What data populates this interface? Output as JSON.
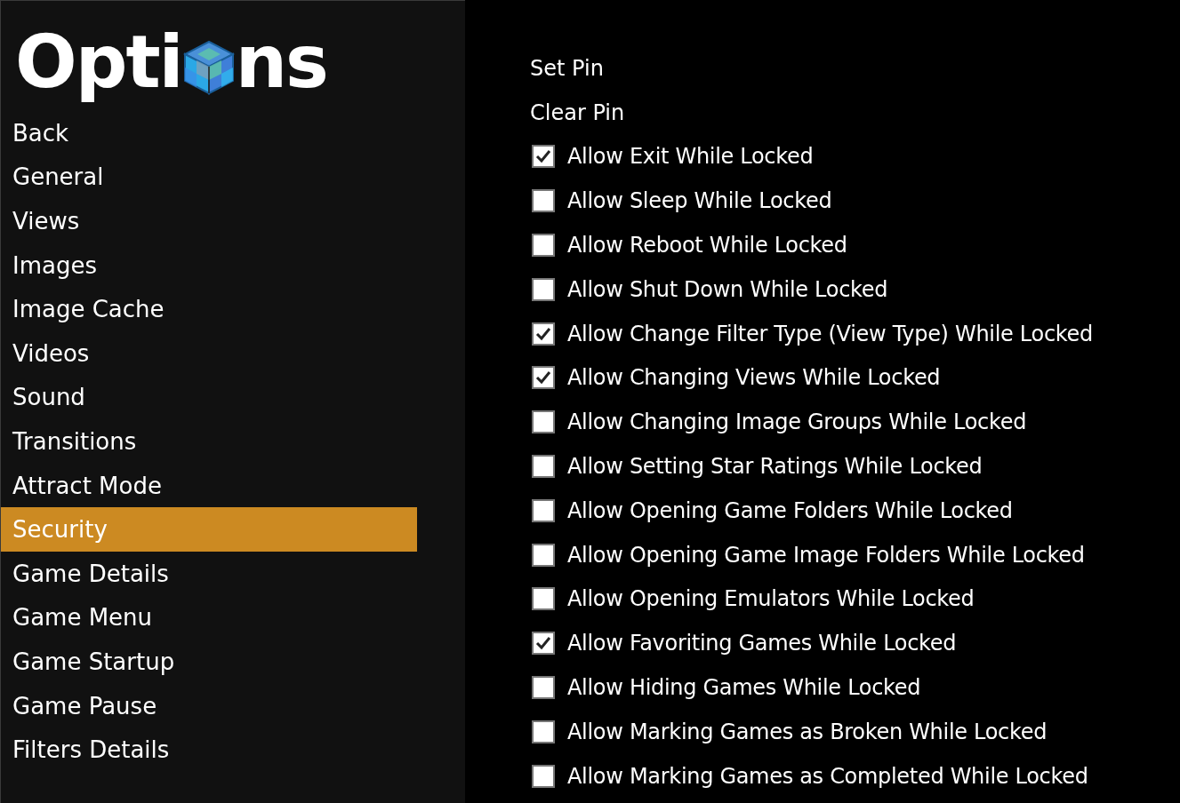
{
  "logo": {
    "before": "Opti",
    "after": "ns"
  },
  "sidebar": {
    "items": [
      {
        "label": "Back",
        "selected": false
      },
      {
        "label": "General",
        "selected": false
      },
      {
        "label": "Views",
        "selected": false
      },
      {
        "label": "Images",
        "selected": false
      },
      {
        "label": "Image Cache",
        "selected": false
      },
      {
        "label": "Videos",
        "selected": false
      },
      {
        "label": "Sound",
        "selected": false
      },
      {
        "label": "Transitions",
        "selected": false
      },
      {
        "label": "Attract Mode",
        "selected": false
      },
      {
        "label": "Security",
        "selected": true
      },
      {
        "label": "Game Details",
        "selected": false
      },
      {
        "label": "Game Menu",
        "selected": false
      },
      {
        "label": "Game Startup",
        "selected": false
      },
      {
        "label": "Game Pause",
        "selected": false
      },
      {
        "label": "Filters Details",
        "selected": false
      }
    ]
  },
  "options": [
    {
      "kind": "action",
      "label": "Set Pin"
    },
    {
      "kind": "action",
      "label": "Clear Pin"
    },
    {
      "kind": "checkbox",
      "label": "Allow Exit While Locked",
      "checked": true
    },
    {
      "kind": "checkbox",
      "label": "Allow Sleep While Locked",
      "checked": false
    },
    {
      "kind": "checkbox",
      "label": "Allow Reboot While Locked",
      "checked": false
    },
    {
      "kind": "checkbox",
      "label": "Allow Shut Down While Locked",
      "checked": false
    },
    {
      "kind": "checkbox",
      "label": "Allow Change Filter Type (View Type) While Locked",
      "checked": true
    },
    {
      "kind": "checkbox",
      "label": "Allow Changing Views While Locked",
      "checked": true
    },
    {
      "kind": "checkbox",
      "label": "Allow Changing Image Groups While Locked",
      "checked": false
    },
    {
      "kind": "checkbox",
      "label": "Allow Setting Star Ratings While Locked",
      "checked": false
    },
    {
      "kind": "checkbox",
      "label": "Allow Opening Game Folders While Locked",
      "checked": false
    },
    {
      "kind": "checkbox",
      "label": "Allow Opening Game Image Folders While Locked",
      "checked": false
    },
    {
      "kind": "checkbox",
      "label": "Allow Opening Emulators While Locked",
      "checked": false
    },
    {
      "kind": "checkbox",
      "label": "Allow Favoriting Games While Locked",
      "checked": true
    },
    {
      "kind": "checkbox",
      "label": "Allow Hiding Games While Locked",
      "checked": false
    },
    {
      "kind": "checkbox",
      "label": "Allow Marking Games as Broken While Locked",
      "checked": false
    },
    {
      "kind": "checkbox",
      "label": "Allow Marking Games as Completed While Locked",
      "checked": false
    }
  ]
}
